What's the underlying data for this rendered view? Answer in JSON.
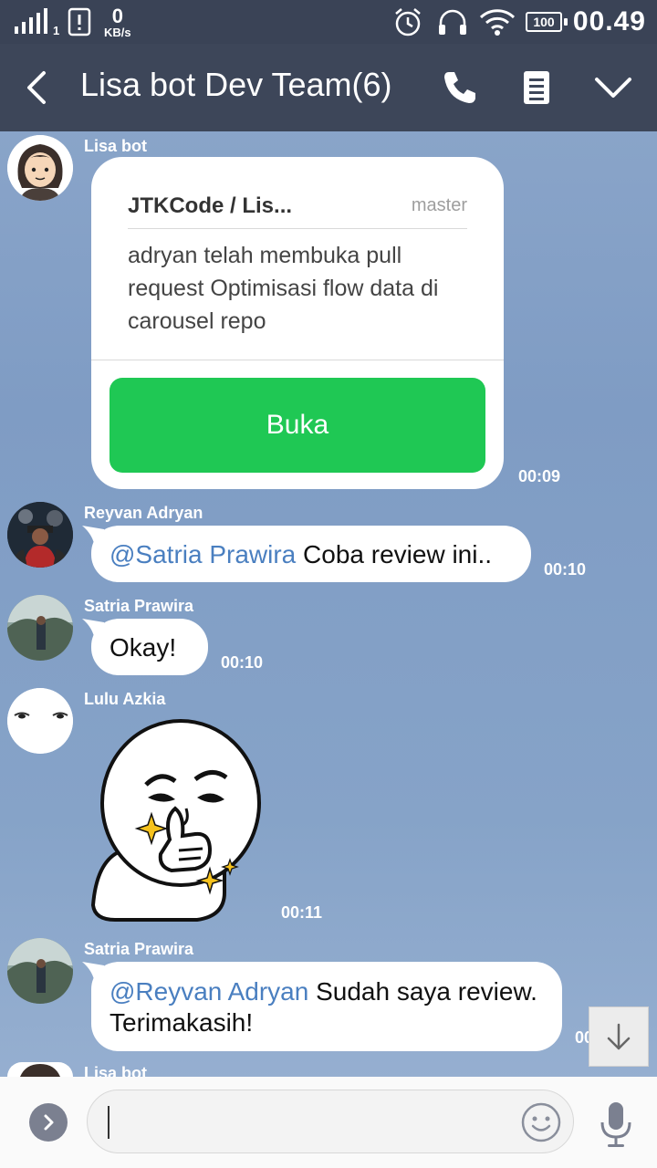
{
  "status_bar": {
    "signal_sub": "1",
    "speed_value": "0",
    "speed_unit": "KB/s",
    "battery": "100",
    "time": "00.49"
  },
  "header": {
    "title": "Lisa bot Dev Team(6)"
  },
  "messages": [
    {
      "sender": "Lisa bot",
      "card": {
        "repo": "JTKCode / Lis...",
        "branch": "master",
        "body": "adryan telah membuka pull request Optimisasi flow data di carousel repo",
        "button": "Buka"
      },
      "time": "00:09"
    },
    {
      "sender": "Reyvan Adryan",
      "mention": "@Satria Prawira",
      "text": " Coba review ini..",
      "time": "00:10"
    },
    {
      "sender": "Satria Prawira",
      "text": "Okay!",
      "time": "00:10"
    },
    {
      "sender": "Lulu Azkia",
      "sticker": "thinking-face-sticker",
      "time": "00:11"
    },
    {
      "sender": "Satria Prawira",
      "mention": "@Reyvan Adryan",
      "text": " Sudah saya review. Terimakasih!",
      "time": "00:11"
    },
    {
      "sender": "Lisa bot"
    }
  ],
  "colors": {
    "header_bg": "#3d4659",
    "status_bg": "#3a4356",
    "mention": "#4a7fc0",
    "button_green": "#1fc854"
  }
}
